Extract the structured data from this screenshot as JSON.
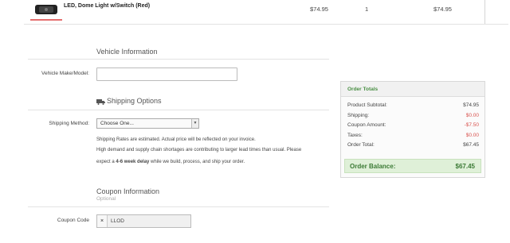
{
  "product": {
    "name": "LED, Dome Light w/Switch (Red)",
    "price": "$74.95",
    "quantity": "1",
    "total": "$74.95"
  },
  "vehicle": {
    "title": "Vehicle Information",
    "make_model_label": "Vehicle Make/Model:",
    "make_model_value": ""
  },
  "shipping": {
    "title": "Shipping Options",
    "method_label": "Shipping Method:",
    "method_selected": "Choose One...",
    "note1": "Shipping Rates are estimated. Actual price will be reflected on your invoice.",
    "note2": "High demand and supply chain shortages are contributing to larger lead times than usual. Please",
    "note3_pre": "expect a ",
    "note3_bold": "4-6 week delay",
    "note3_post": " while we build, process, and ship your order."
  },
  "coupon": {
    "title": "Coupon Information",
    "subtitle": "Optional",
    "label": "Coupon Code",
    "value": "LLOD",
    "remove": "×"
  },
  "totals": {
    "title": "Order Totals",
    "rows": [
      {
        "label": "Product Subtotal:",
        "value": "$74.95"
      },
      {
        "label": "Shipping:",
        "value": "$0.00"
      },
      {
        "label": "Coupon Amount:",
        "value": "-$7.50"
      },
      {
        "label": "Taxes:",
        "value": "$0.00"
      },
      {
        "label": "Order Total:",
        "value": "$67.45"
      }
    ],
    "balance_label": "Order Balance:",
    "balance_value": "$67.45"
  },
  "colors": {
    "accent_green": "#4a8f44",
    "discount_red": "#d9534f",
    "balance_bg": "#dff0d8"
  }
}
